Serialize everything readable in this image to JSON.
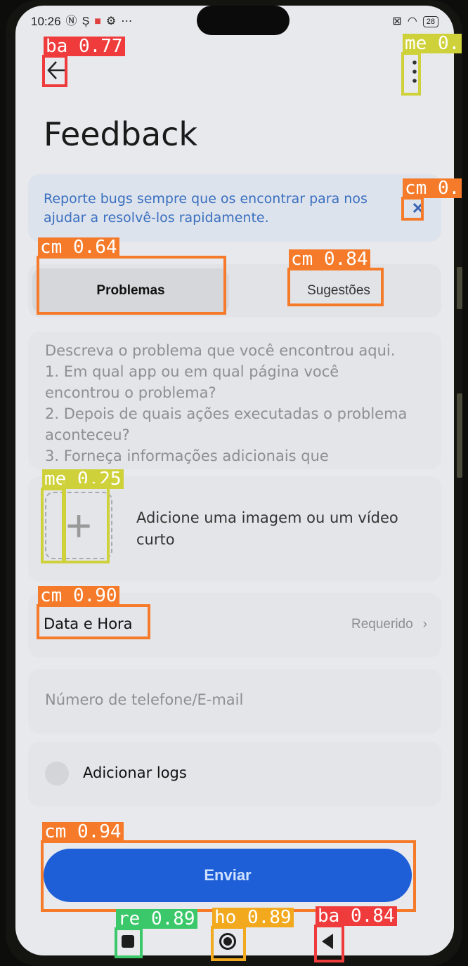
{
  "status_bar": {
    "time": "10:26",
    "battery": "28",
    "icons": [
      "nfc-icon",
      "sim-icon",
      "notification-icon",
      "settings-icon",
      "more-dots-icon",
      "sim-off-icon",
      "wifi-icon",
      "battery-icon"
    ]
  },
  "header": {
    "back_icon": "arrow-left-icon",
    "menu_icon": "more-vertical-icon",
    "title": "Feedback"
  },
  "banner": {
    "text": "Reporte bugs sempre que os encontrar para nos ajudar a resolvê-los rapidamente.",
    "close_icon": "close-icon"
  },
  "tabs": [
    {
      "label": "Problemas",
      "active": true
    },
    {
      "label": "Sugestões",
      "active": false
    }
  ],
  "description": {
    "placeholder": "Descreva o problema que você encontrou aqui.\n1. Em qual app ou em qual página você encontrou o problema?\n2. Depois de quais ações executadas o problema aconteceu?\n3. Forneça informações adicionais que"
  },
  "media": {
    "label": "Adicione uma imagem ou um vídeo curto"
  },
  "datetime": {
    "label": "Data e Hora",
    "value": "Requerido"
  },
  "contact": {
    "placeholder": "Número de telefone/E-mail"
  },
  "logs": {
    "label": "Adicionar logs"
  },
  "submit": {
    "label": "Enviar"
  },
  "detections": [
    {
      "label": "ba 0.77",
      "color": "#ef3b3b"
    },
    {
      "label": "me 0.",
      "color": "#cfd13a"
    },
    {
      "label": "cm 0.",
      "color": "#f57b2a"
    },
    {
      "label": "cm 0.64",
      "color": "#f57b2a"
    },
    {
      "label": "cm 0.84",
      "color": "#f57b2a"
    },
    {
      "label": "me 0.25",
      "color": "#cfd13a"
    },
    {
      "label": "cm 0.90",
      "color": "#f57b2a"
    },
    {
      "label": "cm 0.94",
      "color": "#f57b2a"
    },
    {
      "label": "re 0.89",
      "color": "#3bc86a"
    },
    {
      "label": "ho 0.89",
      "color": "#f2a91e"
    },
    {
      "label": "ba 0.84",
      "color": "#ef3b3b"
    }
  ]
}
